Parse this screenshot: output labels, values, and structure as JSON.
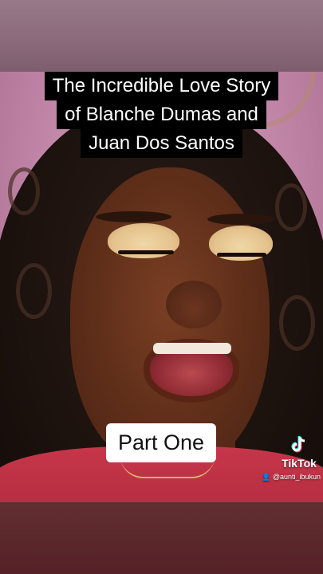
{
  "title_lines": [
    "The Incredible Love Story",
    "of Blanche Dumas and",
    "Juan Dos Santos"
  ],
  "part_label": "Part One",
  "watermark": {
    "brand": "TikTok",
    "username": "@aunti_ibukun",
    "icon": "tiktok-logo-icon"
  },
  "colors": {
    "background": "#c48aab",
    "caption_bg": "#000000",
    "caption_text": "#ffffff",
    "part_bg": "#ffffff",
    "shirt": "#c7364a"
  }
}
